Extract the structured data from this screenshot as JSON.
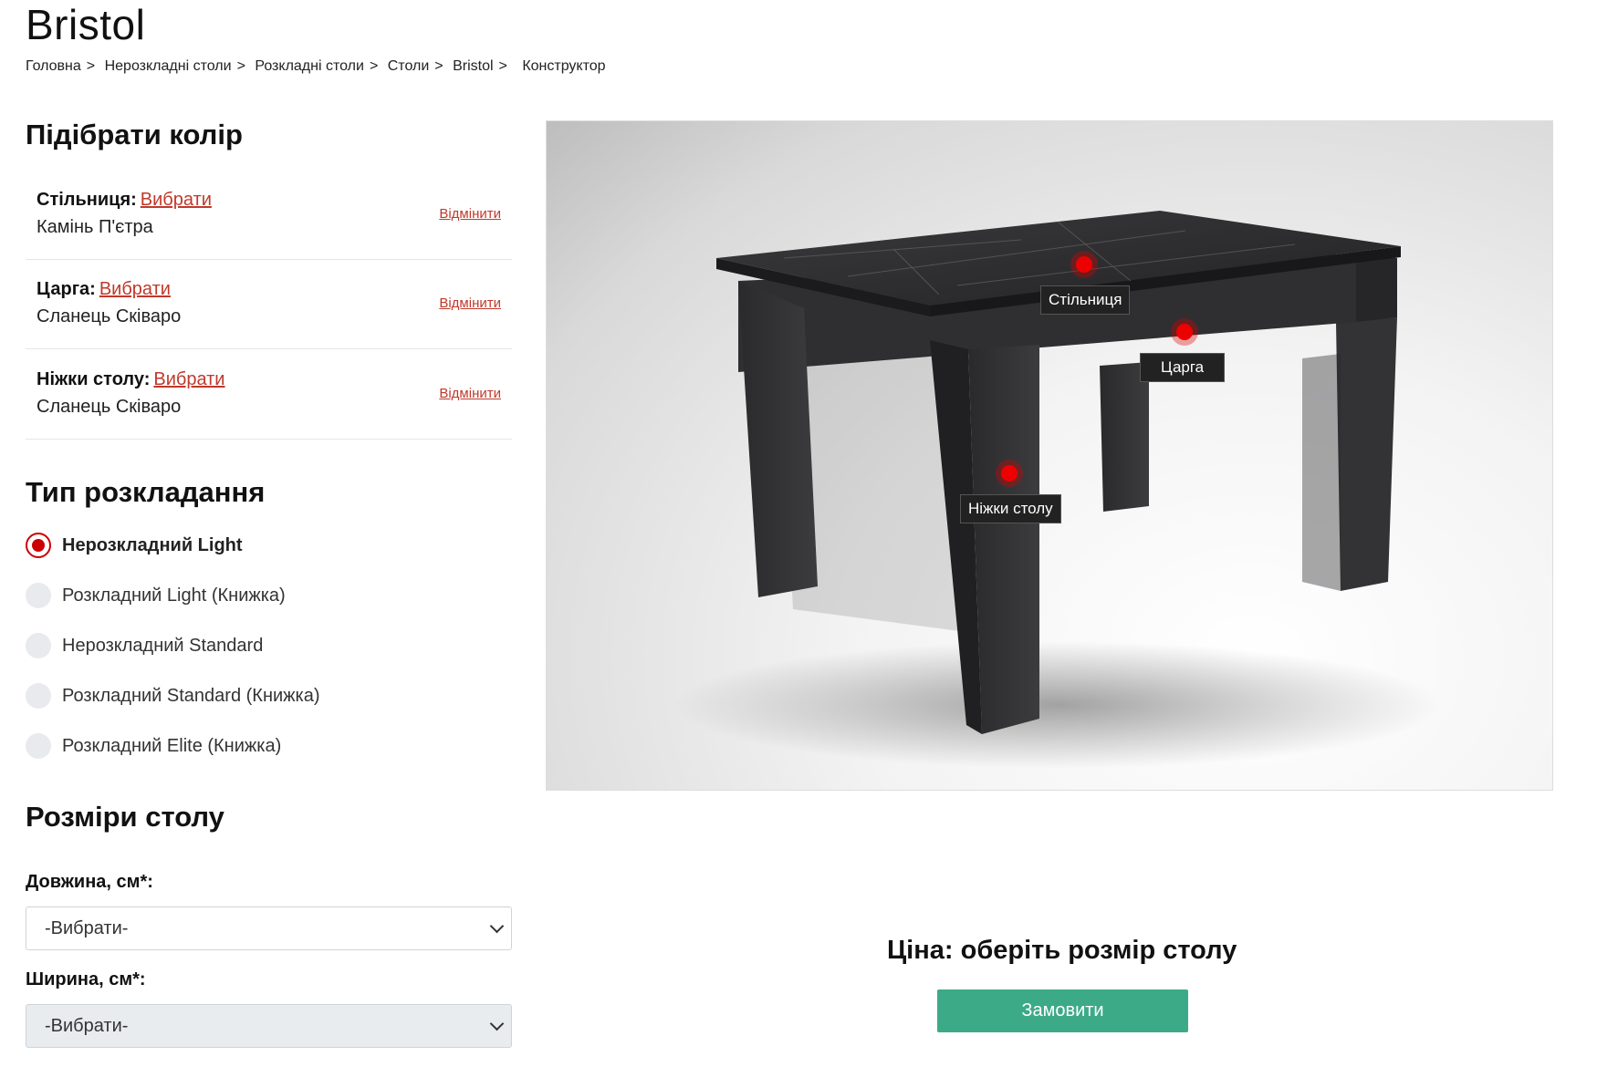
{
  "page_title": "Bristol",
  "breadcrumb": [
    "Головна",
    "Нерозкладні столи",
    "Розкладні столи",
    "Столи",
    "Bristol",
    "Конструктор"
  ],
  "breadcrumb_sep": ">",
  "color_section": {
    "title": "Підібрати колір",
    "choose_label": "Вибрати",
    "cancel_label": "Відмінити",
    "items": [
      {
        "label": "Стільниця:",
        "value": "Камінь П'єтра"
      },
      {
        "label": "Царга:",
        "value": "Сланець Сківаро"
      },
      {
        "label": "Ніжки столу:",
        "value": "Сланець Сківаро"
      }
    ]
  },
  "layout_section": {
    "title": "Тип розкладання",
    "options": [
      {
        "label": "Нерозкладний Light",
        "selected": true
      },
      {
        "label": "Розкладний Light (Книжка)",
        "selected": false
      },
      {
        "label": "Нерозкладний Standard",
        "selected": false
      },
      {
        "label": "Розкладний Standard (Книжка)",
        "selected": false
      },
      {
        "label": "Розкладний Elite (Книжка)",
        "selected": false
      }
    ]
  },
  "size_section": {
    "title": "Розміри столу",
    "length_label": "Довжина, см*:",
    "length_value": "-Вибрати-",
    "width_label": "Ширина, см*:",
    "width_value": "-Вибрати-"
  },
  "viewer": {
    "hotspots": [
      {
        "label": "Стільниця"
      },
      {
        "label": "Царга"
      },
      {
        "label": "Ніжки столу"
      }
    ]
  },
  "price_text": "Ціна: оберіть розмір столу",
  "order_label": "Замовити",
  "colors": {
    "accent_red": "#c00000",
    "link_red": "#c0392b",
    "order_green": "#3daa87",
    "table_dark": "#2b2b2d"
  }
}
